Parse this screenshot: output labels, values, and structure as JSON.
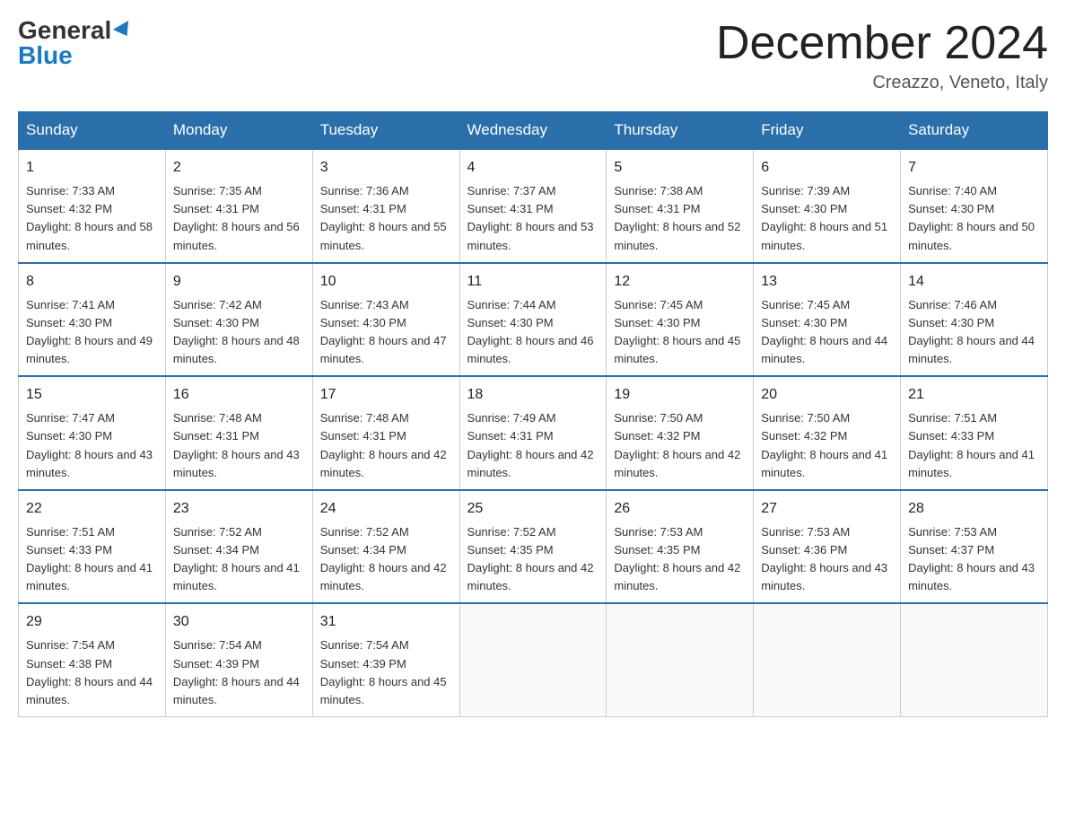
{
  "header": {
    "logo_general": "General",
    "logo_blue": "Blue",
    "month_title": "December 2024",
    "location": "Creazzo, Veneto, Italy"
  },
  "days_of_week": [
    "Sunday",
    "Monday",
    "Tuesday",
    "Wednesday",
    "Thursday",
    "Friday",
    "Saturday"
  ],
  "weeks": [
    [
      {
        "num": "1",
        "sunrise": "7:33 AM",
        "sunset": "4:32 PM",
        "daylight": "8 hours and 58 minutes."
      },
      {
        "num": "2",
        "sunrise": "7:35 AM",
        "sunset": "4:31 PM",
        "daylight": "8 hours and 56 minutes."
      },
      {
        "num": "3",
        "sunrise": "7:36 AM",
        "sunset": "4:31 PM",
        "daylight": "8 hours and 55 minutes."
      },
      {
        "num": "4",
        "sunrise": "7:37 AM",
        "sunset": "4:31 PM",
        "daylight": "8 hours and 53 minutes."
      },
      {
        "num": "5",
        "sunrise": "7:38 AM",
        "sunset": "4:31 PM",
        "daylight": "8 hours and 52 minutes."
      },
      {
        "num": "6",
        "sunrise": "7:39 AM",
        "sunset": "4:30 PM",
        "daylight": "8 hours and 51 minutes."
      },
      {
        "num": "7",
        "sunrise": "7:40 AM",
        "sunset": "4:30 PM",
        "daylight": "8 hours and 50 minutes."
      }
    ],
    [
      {
        "num": "8",
        "sunrise": "7:41 AM",
        "sunset": "4:30 PM",
        "daylight": "8 hours and 49 minutes."
      },
      {
        "num": "9",
        "sunrise": "7:42 AM",
        "sunset": "4:30 PM",
        "daylight": "8 hours and 48 minutes."
      },
      {
        "num": "10",
        "sunrise": "7:43 AM",
        "sunset": "4:30 PM",
        "daylight": "8 hours and 47 minutes."
      },
      {
        "num": "11",
        "sunrise": "7:44 AM",
        "sunset": "4:30 PM",
        "daylight": "8 hours and 46 minutes."
      },
      {
        "num": "12",
        "sunrise": "7:45 AM",
        "sunset": "4:30 PM",
        "daylight": "8 hours and 45 minutes."
      },
      {
        "num": "13",
        "sunrise": "7:45 AM",
        "sunset": "4:30 PM",
        "daylight": "8 hours and 44 minutes."
      },
      {
        "num": "14",
        "sunrise": "7:46 AM",
        "sunset": "4:30 PM",
        "daylight": "8 hours and 44 minutes."
      }
    ],
    [
      {
        "num": "15",
        "sunrise": "7:47 AM",
        "sunset": "4:30 PM",
        "daylight": "8 hours and 43 minutes."
      },
      {
        "num": "16",
        "sunrise": "7:48 AM",
        "sunset": "4:31 PM",
        "daylight": "8 hours and 43 minutes."
      },
      {
        "num": "17",
        "sunrise": "7:48 AM",
        "sunset": "4:31 PM",
        "daylight": "8 hours and 42 minutes."
      },
      {
        "num": "18",
        "sunrise": "7:49 AM",
        "sunset": "4:31 PM",
        "daylight": "8 hours and 42 minutes."
      },
      {
        "num": "19",
        "sunrise": "7:50 AM",
        "sunset": "4:32 PM",
        "daylight": "8 hours and 42 minutes."
      },
      {
        "num": "20",
        "sunrise": "7:50 AM",
        "sunset": "4:32 PM",
        "daylight": "8 hours and 41 minutes."
      },
      {
        "num": "21",
        "sunrise": "7:51 AM",
        "sunset": "4:33 PM",
        "daylight": "8 hours and 41 minutes."
      }
    ],
    [
      {
        "num": "22",
        "sunrise": "7:51 AM",
        "sunset": "4:33 PM",
        "daylight": "8 hours and 41 minutes."
      },
      {
        "num": "23",
        "sunrise": "7:52 AM",
        "sunset": "4:34 PM",
        "daylight": "8 hours and 41 minutes."
      },
      {
        "num": "24",
        "sunrise": "7:52 AM",
        "sunset": "4:34 PM",
        "daylight": "8 hours and 42 minutes."
      },
      {
        "num": "25",
        "sunrise": "7:52 AM",
        "sunset": "4:35 PM",
        "daylight": "8 hours and 42 minutes."
      },
      {
        "num": "26",
        "sunrise": "7:53 AM",
        "sunset": "4:35 PM",
        "daylight": "8 hours and 42 minutes."
      },
      {
        "num": "27",
        "sunrise": "7:53 AM",
        "sunset": "4:36 PM",
        "daylight": "8 hours and 43 minutes."
      },
      {
        "num": "28",
        "sunrise": "7:53 AM",
        "sunset": "4:37 PM",
        "daylight": "8 hours and 43 minutes."
      }
    ],
    [
      {
        "num": "29",
        "sunrise": "7:54 AM",
        "sunset": "4:38 PM",
        "daylight": "8 hours and 44 minutes."
      },
      {
        "num": "30",
        "sunrise": "7:54 AM",
        "sunset": "4:39 PM",
        "daylight": "8 hours and 44 minutes."
      },
      {
        "num": "31",
        "sunrise": "7:54 AM",
        "sunset": "4:39 PM",
        "daylight": "8 hours and 45 minutes."
      },
      null,
      null,
      null,
      null
    ]
  ]
}
